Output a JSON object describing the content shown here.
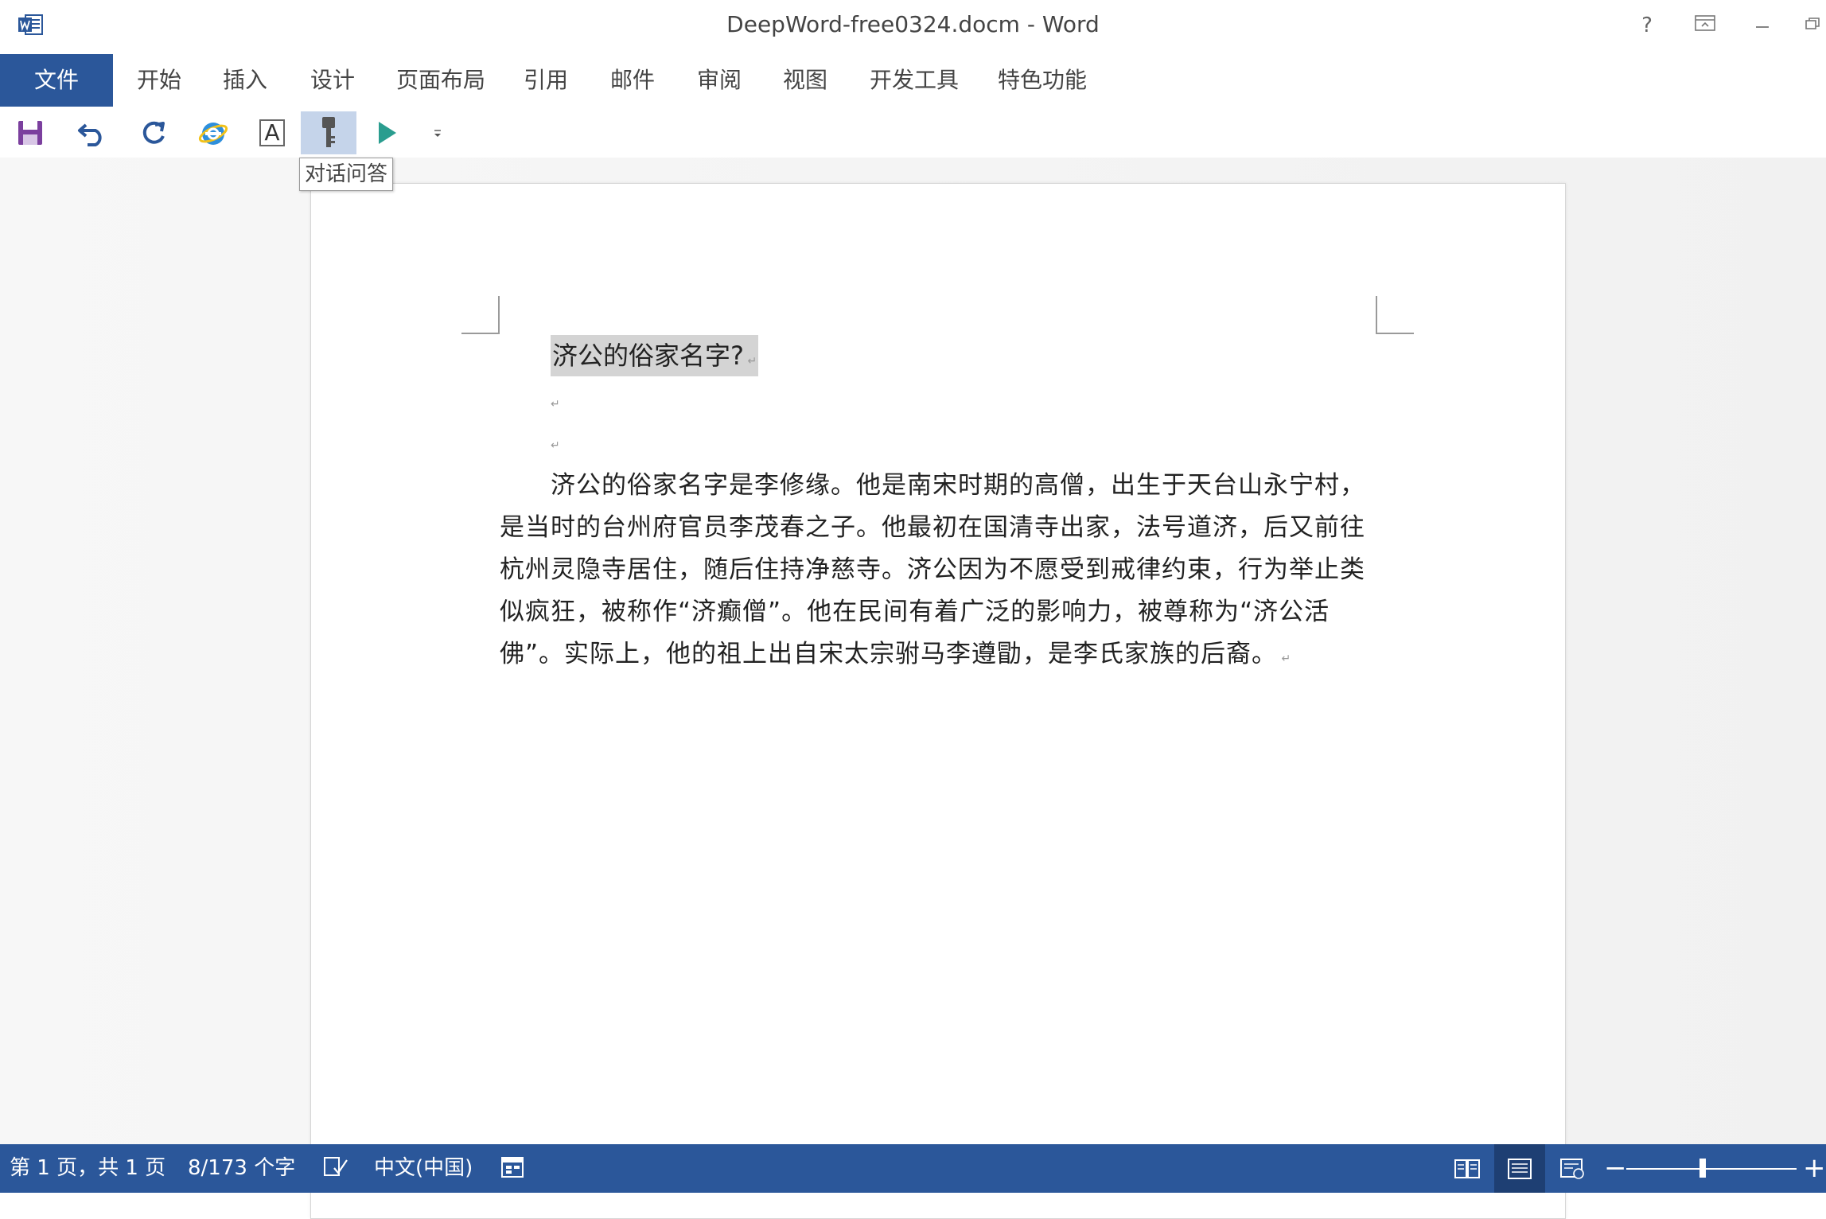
{
  "window": {
    "title": "DeepWord-free0324.docm - Word",
    "help_label": "?"
  },
  "ribbon": {
    "tabs": [
      {
        "label": "文件"
      },
      {
        "label": "开始"
      },
      {
        "label": "插入"
      },
      {
        "label": "设计"
      },
      {
        "label": "页面布局"
      },
      {
        "label": "引用"
      },
      {
        "label": "邮件"
      },
      {
        "label": "审阅"
      },
      {
        "label": "视图"
      },
      {
        "label": "开发工具"
      },
      {
        "label": "特色功能"
      }
    ]
  },
  "quick_access": {
    "icons": [
      "save-icon",
      "undo-icon",
      "redo-icon",
      "ie-browser-icon",
      "text-box-icon",
      "key-icon",
      "run-icon",
      "customize-dropdown-icon"
    ],
    "text_box_glyph": "A",
    "tooltip": "对话问答"
  },
  "document": {
    "heading": "济公的俗家名字?",
    "paragraph": "济公的俗家名字是李修缘。他是南宋时期的高僧，出生于天台山永宁村，是当时的台州府官员李茂春之子。他最初在国清寺出家，法号道济，后又前往杭州灵隐寺居住，随后住持净慈寺。济公因为不愿受到戒律约束，行为举止类似疯狂，被称作“济癫僧”。他在民间有着广泛的影响力，被尊称为“济公活佛”。实际上，他的祖上出自宋太宗驸马李遵勖，是李氏家族的后裔。"
  },
  "status_bar": {
    "page_info": "第 1 页，共 1 页",
    "word_count": "8/173 个字",
    "language": "中文(中国)",
    "accent_color": "#2b579a"
  }
}
